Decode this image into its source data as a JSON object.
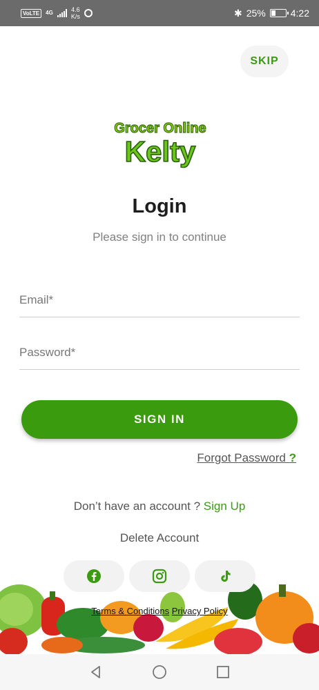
{
  "status_bar": {
    "volte": "VoLTE",
    "network": "4G",
    "speed_value": "4.6",
    "speed_unit": "K/s",
    "battery": "25%",
    "time": "4:22"
  },
  "skip_label": "SKIP",
  "logo": {
    "line1": "Grocer Online",
    "line2": "Kelty"
  },
  "title": "Login",
  "subtitle": "Please sign in to continue",
  "email": {
    "placeholder": "Email*",
    "value": ""
  },
  "password": {
    "placeholder": "Password*",
    "value": ""
  },
  "signin_label": "SIGN IN",
  "forgot": {
    "text": "Forgot Password ",
    "mark": "?"
  },
  "signup": {
    "prompt": "Don’t have an account ? ",
    "link": "Sign Up"
  },
  "delete_account": "Delete Account",
  "social": [
    "facebook-icon",
    "instagram-icon",
    "tiktok-icon"
  ],
  "legal": {
    "terms": "Terms & Conditions",
    "privacy": "Privacy Policy"
  },
  "colors": {
    "brand_green": "#3b9b0e",
    "status_bar": "#6b6b6b"
  }
}
